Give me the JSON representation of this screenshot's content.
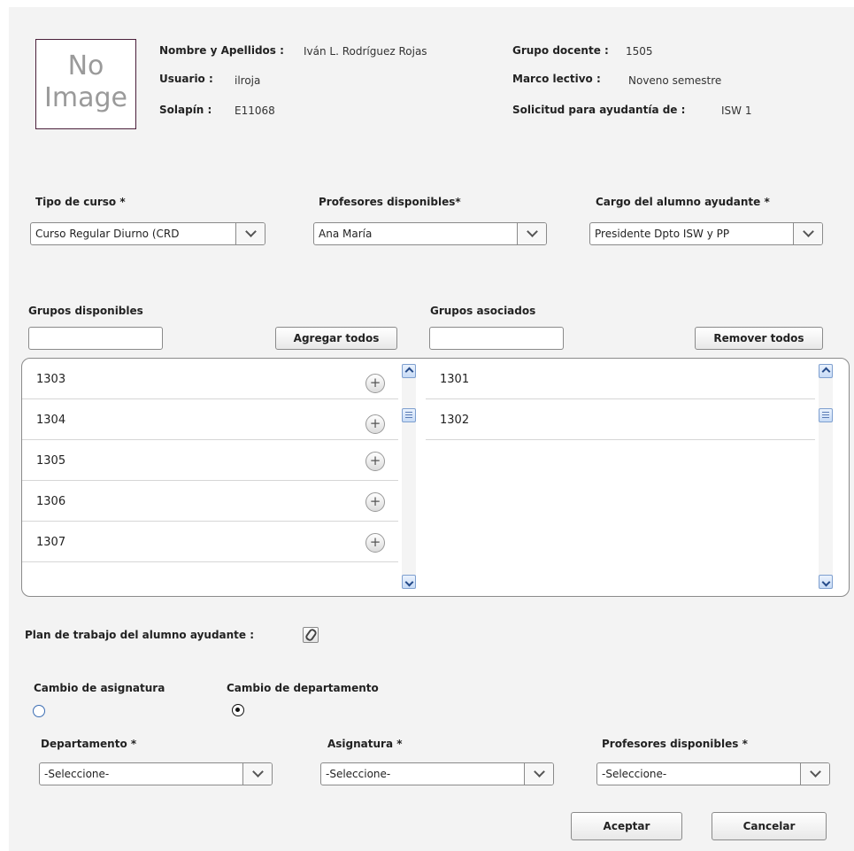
{
  "profile": {
    "no_image_line1": "No",
    "no_image_line2": "Image",
    "name_label": "Nombre y Apellidos :",
    "name_value": "Iván L. Rodríguez Rojas",
    "user_label": "Usuario :",
    "user_value": "ilroja",
    "badge_label": "Solapín :",
    "badge_value": "E11068",
    "group_label": "Grupo docente :",
    "group_value": "1505",
    "period_label": "Marco lectivo :",
    "period_value": "Noveno semestre",
    "request_label": "Solicitud para ayudantía de :",
    "request_value": "ISW 1"
  },
  "course_filters": {
    "course_type_label": "Tipo de curso *",
    "course_type_value": "Curso Regular Diurno (CRD",
    "teachers_label": "Profesores disponibles*",
    "teachers_value": "Ana María",
    "role_label": "Cargo del alumno ayudante *",
    "role_value": "Presidente Dpto ISW y PP"
  },
  "groups": {
    "available_label": "Grupos disponibles",
    "associated_label": "Grupos asociados",
    "add_all_label": "Agregar todos",
    "remove_all_label": "Remover todos",
    "available_search_value": "",
    "associated_search_value": "",
    "available": [
      "1303",
      "1304",
      "1305",
      "1306",
      "1307"
    ],
    "associated": [
      "1301",
      "1302"
    ]
  },
  "work_plan": {
    "label": "Plan de trabajo del alumno ayudante :"
  },
  "change": {
    "subject_change_label": "Cambio de asignatura",
    "dept_change_label": "Cambio de departamento",
    "selected": "Cambio de departamento"
  },
  "dept_filters": {
    "department_label": "Departamento *",
    "department_value": "-Seleccione-",
    "subject_label": "Asignatura *",
    "subject_value": "-Seleccione-",
    "teachers_label": "Profesores disponibles *",
    "teachers_value": "-Seleccione-"
  },
  "actions": {
    "accept_label": "Aceptar",
    "cancel_label": "Cancelar"
  },
  "colors": {
    "panel_bg": "#f3f3f3",
    "scroll_accent": "#c7dbf6"
  }
}
